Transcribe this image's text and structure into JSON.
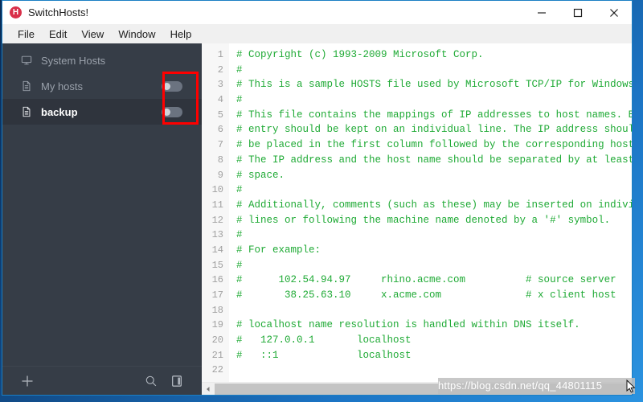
{
  "window": {
    "title": "SwitchHosts!",
    "app_icon_letter": "H",
    "app_icon_color": "#d9304a",
    "controls": {
      "minimize": "minimize-button",
      "maximize": "maximize-button",
      "close": "close-button"
    }
  },
  "menubar": {
    "items": [
      {
        "label": "File"
      },
      {
        "label": "Edit"
      },
      {
        "label": "View"
      },
      {
        "label": "Window"
      },
      {
        "label": "Help"
      }
    ]
  },
  "sidebar": {
    "items": [
      {
        "label": "System Hosts",
        "icon": "monitor-icon",
        "selected": false,
        "has_toggle": false,
        "toggle_on": false
      },
      {
        "label": "My hosts",
        "icon": "document-icon",
        "selected": false,
        "has_toggle": true,
        "toggle_on": false
      },
      {
        "label": "backup",
        "icon": "document-icon",
        "selected": true,
        "has_toggle": true,
        "toggle_on": false
      }
    ],
    "toolbar": {
      "add_label": "+",
      "add_name": "plus-icon",
      "search_name": "search-icon",
      "panel_name": "toggle-panel-icon"
    },
    "annotation": {
      "color": "#fe0000",
      "target": "host-toggles"
    },
    "background_color": "#363d47",
    "selected_color": "#2f343d"
  },
  "editor": {
    "text_color": "#1faa35",
    "line_numbers": [
      1,
      2,
      3,
      4,
      5,
      6,
      7,
      8,
      9,
      10,
      11,
      12,
      13,
      14,
      15,
      16,
      17,
      18,
      19,
      20,
      21,
      22
    ],
    "lines": [
      "# Copyright (c) 1993-2009 Microsoft Corp.",
      "#",
      "# This is a sample HOSTS file used by Microsoft TCP/IP for Windows.",
      "#",
      "# This file contains the mappings of IP addresses to host names. Each",
      "# entry should be kept on an individual line. The IP address should",
      "# be placed in the first column followed by the corresponding host name.",
      "# The IP address and the host name should be separated by at least one",
      "# space.",
      "#",
      "# Additionally, comments (such as these) may be inserted on individual",
      "# lines or following the machine name denoted by a '#' symbol.",
      "#",
      "# For example:",
      "#",
      "#      102.54.94.97     rhino.acme.com          # source server",
      "#       38.25.63.10     x.acme.com              # x client host",
      "",
      "# localhost name resolution is handled within DNS itself.",
      "#   127.0.0.1       localhost",
      "#   ::1             localhost",
      ""
    ]
  },
  "desktop": {
    "watermark": "https://blog.csdn.net/qq_44801115"
  }
}
